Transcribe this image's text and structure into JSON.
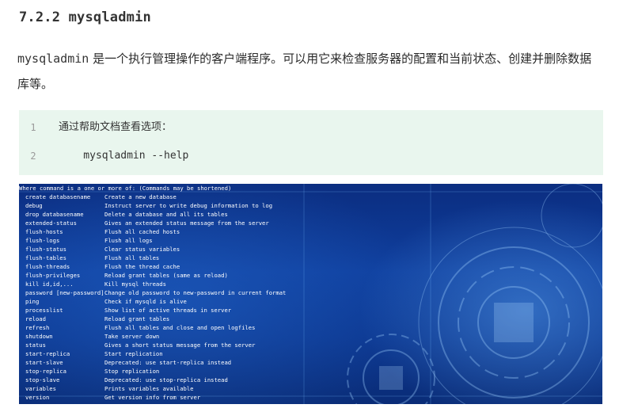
{
  "heading": "7.2.2 mysqladmin",
  "intro": {
    "code": "mysqladmin",
    "text": " 是一个执行管理操作的客户端程序。可以用它来检查服务器的配置和当前状态、创建并删除数据库等。"
  },
  "code_block": [
    {
      "line": "1",
      "text": "通过帮助文档查看选项："
    },
    {
      "line": "2",
      "text": "    mysqladmin --help"
    }
  ],
  "terminal": {
    "header": "Where command is a one or more of: (Commands may be shortened)",
    "commands": [
      {
        "cmd": "create databasename",
        "desc": "Create a new database"
      },
      {
        "cmd": "debug",
        "desc": "Instruct server to write debug information to log"
      },
      {
        "cmd": "drop databasename",
        "desc": "Delete a database and all its tables"
      },
      {
        "cmd": "extended-status",
        "desc": "Gives an extended status message from the server"
      },
      {
        "cmd": "flush-hosts",
        "desc": "Flush all cached hosts"
      },
      {
        "cmd": "flush-logs",
        "desc": "Flush all logs"
      },
      {
        "cmd": "flush-status",
        "desc": "Clear status variables"
      },
      {
        "cmd": "flush-tables",
        "desc": "Flush all tables"
      },
      {
        "cmd": "flush-threads",
        "desc": "Flush the thread cache"
      },
      {
        "cmd": "flush-privileges",
        "desc": "Reload grant tables (same as reload)"
      },
      {
        "cmd": "kill id,id,...",
        "desc": "Kill mysql threads"
      },
      {
        "cmd": "password [new-password]",
        "desc": "Change old password to new-password in current format"
      },
      {
        "cmd": "ping",
        "desc": "Check if mysqld is alive"
      },
      {
        "cmd": "processlist",
        "desc": "Show list of active threads in server"
      },
      {
        "cmd": "reload",
        "desc": "Reload grant tables"
      },
      {
        "cmd": "refresh",
        "desc": "Flush all tables and close and open logfiles"
      },
      {
        "cmd": "shutdown",
        "desc": "Take server down"
      },
      {
        "cmd": "status",
        "desc": "Gives a short status message from the server"
      },
      {
        "cmd": "start-replica",
        "desc": "Start replication"
      },
      {
        "cmd": "start-slave",
        "desc": "Deprecated: use start-replica instead"
      },
      {
        "cmd": "stop-replica",
        "desc": "Stop replication"
      },
      {
        "cmd": "stop-slave",
        "desc": "Deprecated: use stop-replica instead"
      },
      {
        "cmd": "variables",
        "desc": "Prints variables available"
      },
      {
        "cmd": "version",
        "desc": "Get version info from server"
      }
    ]
  },
  "colors": {
    "code_bg": "#e9f6ee",
    "terminal_bg": "#0f3f9e",
    "terminal_text": "#ffffff"
  }
}
